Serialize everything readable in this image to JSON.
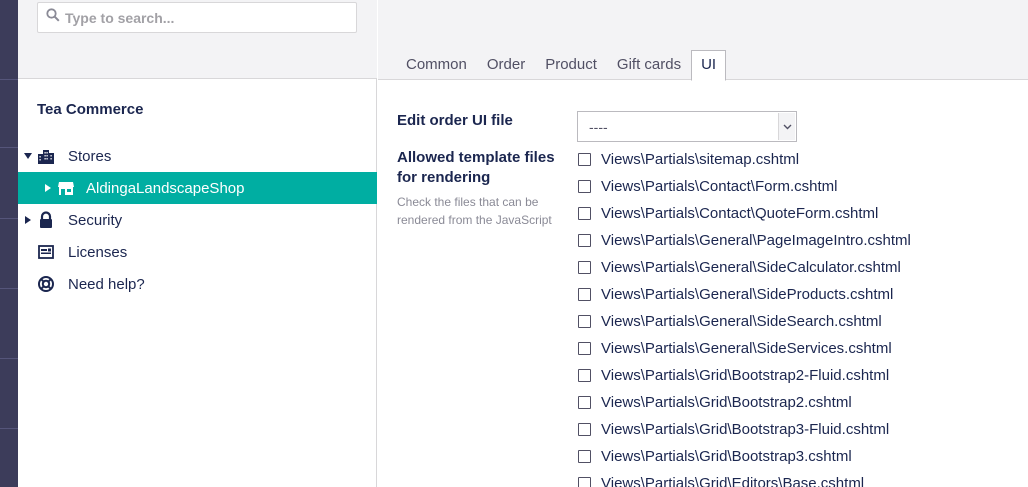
{
  "search": {
    "placeholder": "Type to search..."
  },
  "tree": {
    "title": "Tea Commerce",
    "items": [
      {
        "label": "Stores",
        "icon": "stores-icon"
      },
      {
        "label": "AldingaLandscapeShop",
        "icon": "shop-icon"
      },
      {
        "label": "Security",
        "icon": "lock-icon"
      },
      {
        "label": "Licenses",
        "icon": "license-icon"
      },
      {
        "label": "Need help?",
        "icon": "lifebuoy-icon"
      }
    ]
  },
  "tabs": [
    "Common",
    "Order",
    "Product",
    "Gift cards",
    "UI"
  ],
  "form": {
    "edit_order_label": "Edit order UI file",
    "edit_order_value": "----",
    "allowed_label_line1": "Allowed template files",
    "allowed_label_line2": "for rendering",
    "allowed_desc": "Check the files that can be rendered from the JavaScript",
    "files": [
      "Views\\Partials\\sitemap.cshtml",
      "Views\\Partials\\Contact\\Form.cshtml",
      "Views\\Partials\\Contact\\QuoteForm.cshtml",
      "Views\\Partials\\General\\PageImageIntro.cshtml",
      "Views\\Partials\\General\\SideCalculator.cshtml",
      "Views\\Partials\\General\\SideProducts.cshtml",
      "Views\\Partials\\General\\SideSearch.cshtml",
      "Views\\Partials\\General\\SideServices.cshtml",
      "Views\\Partials\\Grid\\Bootstrap2-Fluid.cshtml",
      "Views\\Partials\\Grid\\Bootstrap2.cshtml",
      "Views\\Partials\\Grid\\Bootstrap3-Fluid.cshtml",
      "Views\\Partials\\Grid\\Bootstrap3.cshtml",
      "Views\\Partials\\Grid\\Editors\\Base.cshtml"
    ]
  },
  "colors": {
    "accent": "#00aea2",
    "rail": "#3c3c5a",
    "text": "#1b264f"
  }
}
